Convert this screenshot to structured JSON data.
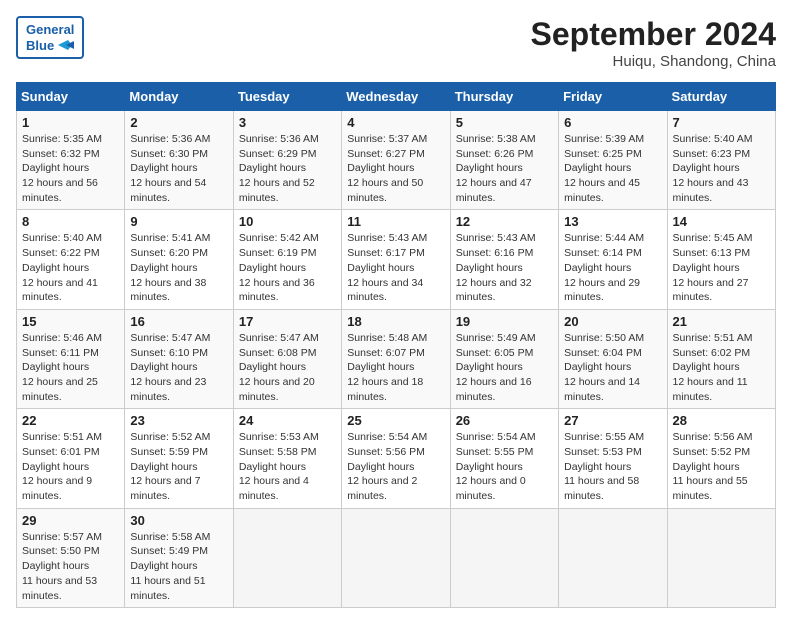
{
  "header": {
    "logo_line1": "General",
    "logo_line2": "Blue",
    "month_title": "September 2024",
    "location": "Huiqu, Shandong, China"
  },
  "weekdays": [
    "Sunday",
    "Monday",
    "Tuesday",
    "Wednesday",
    "Thursday",
    "Friday",
    "Saturday"
  ],
  "weeks": [
    [
      {
        "day": "1",
        "sunrise": "5:35 AM",
        "sunset": "6:32 PM",
        "daylight": "12 hours and 56 minutes."
      },
      {
        "day": "2",
        "sunrise": "5:36 AM",
        "sunset": "6:30 PM",
        "daylight": "12 hours and 54 minutes."
      },
      {
        "day": "3",
        "sunrise": "5:36 AM",
        "sunset": "6:29 PM",
        "daylight": "12 hours and 52 minutes."
      },
      {
        "day": "4",
        "sunrise": "5:37 AM",
        "sunset": "6:27 PM",
        "daylight": "12 hours and 50 minutes."
      },
      {
        "day": "5",
        "sunrise": "5:38 AM",
        "sunset": "6:26 PM",
        "daylight": "12 hours and 47 minutes."
      },
      {
        "day": "6",
        "sunrise": "5:39 AM",
        "sunset": "6:25 PM",
        "daylight": "12 hours and 45 minutes."
      },
      {
        "day": "7",
        "sunrise": "5:40 AM",
        "sunset": "6:23 PM",
        "daylight": "12 hours and 43 minutes."
      }
    ],
    [
      {
        "day": "8",
        "sunrise": "5:40 AM",
        "sunset": "6:22 PM",
        "daylight": "12 hours and 41 minutes."
      },
      {
        "day": "9",
        "sunrise": "5:41 AM",
        "sunset": "6:20 PM",
        "daylight": "12 hours and 38 minutes."
      },
      {
        "day": "10",
        "sunrise": "5:42 AM",
        "sunset": "6:19 PM",
        "daylight": "12 hours and 36 minutes."
      },
      {
        "day": "11",
        "sunrise": "5:43 AM",
        "sunset": "6:17 PM",
        "daylight": "12 hours and 34 minutes."
      },
      {
        "day": "12",
        "sunrise": "5:43 AM",
        "sunset": "6:16 PM",
        "daylight": "12 hours and 32 minutes."
      },
      {
        "day": "13",
        "sunrise": "5:44 AM",
        "sunset": "6:14 PM",
        "daylight": "12 hours and 29 minutes."
      },
      {
        "day": "14",
        "sunrise": "5:45 AM",
        "sunset": "6:13 PM",
        "daylight": "12 hours and 27 minutes."
      }
    ],
    [
      {
        "day": "15",
        "sunrise": "5:46 AM",
        "sunset": "6:11 PM",
        "daylight": "12 hours and 25 minutes."
      },
      {
        "day": "16",
        "sunrise": "5:47 AM",
        "sunset": "6:10 PM",
        "daylight": "12 hours and 23 minutes."
      },
      {
        "day": "17",
        "sunrise": "5:47 AM",
        "sunset": "6:08 PM",
        "daylight": "12 hours and 20 minutes."
      },
      {
        "day": "18",
        "sunrise": "5:48 AM",
        "sunset": "6:07 PM",
        "daylight": "12 hours and 18 minutes."
      },
      {
        "day": "19",
        "sunrise": "5:49 AM",
        "sunset": "6:05 PM",
        "daylight": "12 hours and 16 minutes."
      },
      {
        "day": "20",
        "sunrise": "5:50 AM",
        "sunset": "6:04 PM",
        "daylight": "12 hours and 14 minutes."
      },
      {
        "day": "21",
        "sunrise": "5:51 AM",
        "sunset": "6:02 PM",
        "daylight": "12 hours and 11 minutes."
      }
    ],
    [
      {
        "day": "22",
        "sunrise": "5:51 AM",
        "sunset": "6:01 PM",
        "daylight": "12 hours and 9 minutes."
      },
      {
        "day": "23",
        "sunrise": "5:52 AM",
        "sunset": "5:59 PM",
        "daylight": "12 hours and 7 minutes."
      },
      {
        "day": "24",
        "sunrise": "5:53 AM",
        "sunset": "5:58 PM",
        "daylight": "12 hours and 4 minutes."
      },
      {
        "day": "25",
        "sunrise": "5:54 AM",
        "sunset": "5:56 PM",
        "daylight": "12 hours and 2 minutes."
      },
      {
        "day": "26",
        "sunrise": "5:54 AM",
        "sunset": "5:55 PM",
        "daylight": "12 hours and 0 minutes."
      },
      {
        "day": "27",
        "sunrise": "5:55 AM",
        "sunset": "5:53 PM",
        "daylight": "11 hours and 58 minutes."
      },
      {
        "day": "28",
        "sunrise": "5:56 AM",
        "sunset": "5:52 PM",
        "daylight": "11 hours and 55 minutes."
      }
    ],
    [
      {
        "day": "29",
        "sunrise": "5:57 AM",
        "sunset": "5:50 PM",
        "daylight": "11 hours and 53 minutes."
      },
      {
        "day": "30",
        "sunrise": "5:58 AM",
        "sunset": "5:49 PM",
        "daylight": "11 hours and 51 minutes."
      },
      null,
      null,
      null,
      null,
      null
    ]
  ]
}
